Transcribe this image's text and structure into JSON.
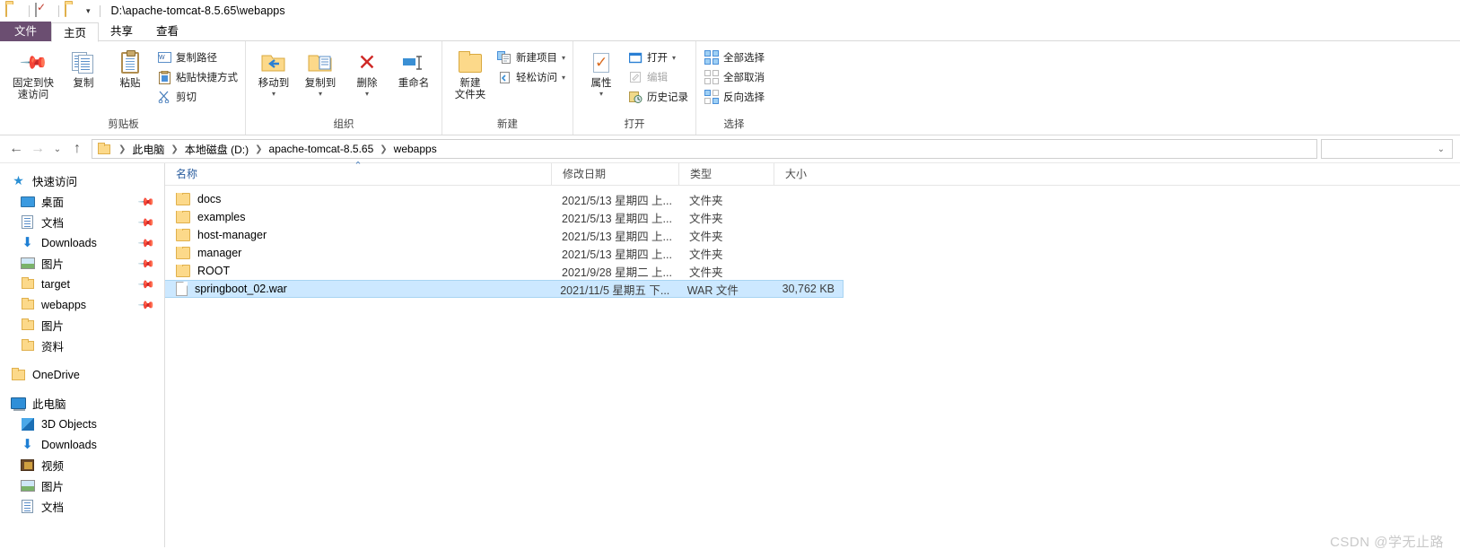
{
  "titlebar": {
    "path": "D:\\apache-tomcat-8.5.65\\webapps",
    "qat_folder_icon": "folder-icon",
    "qat_properties_icon": "properties-check-icon",
    "qat_newfolder_icon": "new-folder-icon",
    "qat_dropdown_icon": "chevron-down-icon"
  },
  "tabs": [
    {
      "label": "文件",
      "name": "tab-file"
    },
    {
      "label": "主页",
      "name": "tab-home"
    },
    {
      "label": "共享",
      "name": "tab-share"
    },
    {
      "label": "查看",
      "name": "tab-view"
    }
  ],
  "ribbon": {
    "groups": [
      {
        "label": "剪贴板",
        "buttons": [
          {
            "label": "固定到快速访问",
            "icon": "pin-icon"
          },
          {
            "label": "复制",
            "icon": "copy-icon"
          },
          {
            "label": "粘贴",
            "icon": "paste-clipboard-icon"
          }
        ],
        "small": [
          {
            "label": "复制路径",
            "icon": "copy-path-icon"
          },
          {
            "label": "粘贴快捷方式",
            "icon": "paste-shortcut-icon"
          },
          {
            "label": "剪切",
            "icon": "scissors-icon"
          }
        ]
      },
      {
        "label": "组织",
        "buttons": [
          {
            "label": "移动到",
            "icon": "move-to-icon"
          },
          {
            "label": "复制到",
            "icon": "copy-to-icon"
          },
          {
            "label": "删除",
            "icon": "delete-x-icon"
          },
          {
            "label": "重命名",
            "icon": "rename-icon"
          }
        ]
      },
      {
        "label": "新建",
        "buttons": [
          {
            "label": "新建\n文件夹",
            "line1": "新建",
            "line2": "文件夹",
            "icon": "new-folder-icon"
          }
        ],
        "small": [
          {
            "label": "新建项目",
            "icon": "new-item-icon"
          },
          {
            "label": "轻松访问",
            "icon": "easy-access-icon"
          }
        ]
      },
      {
        "label": "打开",
        "buttons": [
          {
            "label": "属性",
            "icon": "properties-icon"
          }
        ],
        "small": [
          {
            "label": "打开",
            "icon": "open-icon"
          },
          {
            "label": "编辑",
            "icon": "edit-icon",
            "disabled": true
          },
          {
            "label": "历史记录",
            "icon": "history-icon"
          }
        ]
      },
      {
        "label": "选择",
        "small": [
          {
            "label": "全部选择",
            "icon": "select-all-icon"
          },
          {
            "label": "全部取消",
            "icon": "select-none-icon"
          },
          {
            "label": "反向选择",
            "icon": "invert-selection-icon"
          }
        ]
      }
    ]
  },
  "addressbar": {
    "back_icon": "back-arrow-icon",
    "forward_icon": "forward-arrow-icon",
    "recent_icon": "chevron-down-icon",
    "up_icon": "up-arrow-icon",
    "crumbs": [
      "此电脑",
      "本地磁盘 (D:)",
      "apache-tomcat-8.5.65",
      "webapps"
    ],
    "search_placeholder": "",
    "search_value": "",
    "search_chevron": "chevron-down-icon"
  },
  "navpane": {
    "sections": [
      {
        "root": {
          "label": "快速访问",
          "icon": "star-icon"
        },
        "items": [
          {
            "label": "桌面",
            "icon": "desktop-icon",
            "pinned": true
          },
          {
            "label": "文档",
            "icon": "documents-icon",
            "pinned": true
          },
          {
            "label": "Downloads",
            "icon": "downloads-icon",
            "pinned": true
          },
          {
            "label": "图片",
            "icon": "pictures-icon",
            "pinned": true
          },
          {
            "label": "target",
            "icon": "folder-icon",
            "pinned": true
          },
          {
            "label": "webapps",
            "icon": "folder-icon",
            "pinned": true
          },
          {
            "label": "图片",
            "icon": "folder-icon",
            "pinned": false
          },
          {
            "label": "资料",
            "icon": "folder-icon",
            "pinned": false
          }
        ]
      },
      {
        "root": {
          "label": "OneDrive",
          "icon": "onedrive-folder-icon"
        },
        "items": []
      },
      {
        "root": {
          "label": "此电脑",
          "icon": "this-pc-icon"
        },
        "items": [
          {
            "label": "3D Objects",
            "icon": "3d-objects-icon",
            "pinned": false
          },
          {
            "label": "Downloads",
            "icon": "downloads-icon",
            "pinned": false
          },
          {
            "label": "视频",
            "icon": "videos-icon",
            "pinned": false
          },
          {
            "label": "图片",
            "icon": "pictures-icon",
            "pinned": false
          },
          {
            "label": "文档",
            "icon": "documents-icon",
            "pinned": false
          }
        ]
      }
    ]
  },
  "filelist": {
    "columns": [
      {
        "label": "名称",
        "key": "name",
        "sorted": true,
        "sort_dir": "asc"
      },
      {
        "label": "修改日期",
        "key": "date"
      },
      {
        "label": "类型",
        "key": "type"
      },
      {
        "label": "大小",
        "key": "size"
      }
    ],
    "rows": [
      {
        "name": "docs",
        "date": "2021/5/13 星期四 上...",
        "type": "文件夹",
        "size": "",
        "icon": "folder-icon",
        "selected": false
      },
      {
        "name": "examples",
        "date": "2021/5/13 星期四 上...",
        "type": "文件夹",
        "size": "",
        "icon": "folder-icon",
        "selected": false
      },
      {
        "name": "host-manager",
        "date": "2021/5/13 星期四 上...",
        "type": "文件夹",
        "size": "",
        "icon": "folder-icon",
        "selected": false
      },
      {
        "name": "manager",
        "date": "2021/5/13 星期四 上...",
        "type": "文件夹",
        "size": "",
        "icon": "folder-icon",
        "selected": false
      },
      {
        "name": "ROOT",
        "date": "2021/9/28 星期二 上...",
        "type": "文件夹",
        "size": "",
        "icon": "folder-icon",
        "selected": false
      },
      {
        "name": "springboot_02.war",
        "date": "2021/11/5 星期五 下...",
        "type": "WAR 文件",
        "size": "30,762 KB",
        "icon": "file-icon",
        "selected": true
      }
    ]
  },
  "watermark": {
    "text": "CSDN @学无止路"
  },
  "colors": {
    "file_tab": "#6b4e71",
    "selection": "#cce8ff",
    "sort_header": "#2a5d9e",
    "folder": "#fcd98a"
  }
}
